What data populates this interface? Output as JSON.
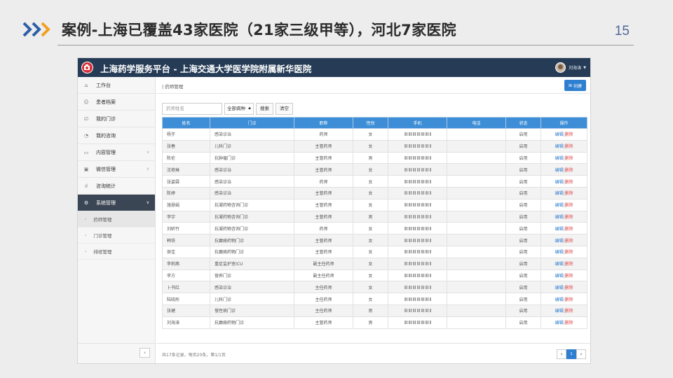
{
  "slide": {
    "title": "案例-上海已覆盖43家医院（21家三级甲等），河北7家医院",
    "page_number": "15"
  },
  "app": {
    "title": "上海药学服务平台 - 上海交通大学医学院附属新华医院",
    "user_name": "刘海涛",
    "brand_color": "#253b56"
  },
  "sidebar": {
    "items": [
      {
        "icon": "home-icon",
        "label": "工作台"
      },
      {
        "icon": "patient-icon",
        "label": "患者档案"
      },
      {
        "icon": "clinic-icon",
        "label": "我的门诊"
      },
      {
        "icon": "consult-icon",
        "label": "我的咨询"
      },
      {
        "icon": "content-icon",
        "label": "内容管理"
      },
      {
        "icon": "wechat-icon",
        "label": "微信管理"
      },
      {
        "icon": "chart-icon",
        "label": "咨询统计"
      },
      {
        "icon": "gears-icon",
        "label": "系统管理"
      }
    ],
    "sub_items": [
      "药师管理",
      "门诊管理",
      "排班管理"
    ]
  },
  "main": {
    "breadcrumb": "药师管理",
    "create_label": "创建",
    "search_placeholder": "药师姓名",
    "select_value": "全部病种",
    "search_label": "搜索",
    "clear_label": "清空"
  },
  "table": {
    "headers": [
      "姓名",
      "门诊",
      "职称",
      "性别",
      "手机",
      "电话",
      "状态",
      "操作"
    ],
    "rows": [
      {
        "name": "杨芋",
        "clinic": "感染诊治",
        "title": "药师",
        "gender": "女",
        "status": "启用"
      },
      {
        "name": "张春",
        "clinic": "儿科门诊",
        "title": "主管药师",
        "gender": "女",
        "status": "启用"
      },
      {
        "name": "陈伦",
        "clinic": "抗肿瘤门诊",
        "title": "主管药师",
        "gender": "男",
        "status": "启用"
      },
      {
        "name": "沈艳琳",
        "clinic": "感染诊治",
        "title": "主管药师",
        "gender": "女",
        "status": "启用"
      },
      {
        "name": "张姿霖",
        "clinic": "感染诊治",
        "title": "药师",
        "gender": "女",
        "status": "启用"
      },
      {
        "name": "陈婷",
        "clinic": "感染诊治",
        "title": "主管药师",
        "gender": "女",
        "status": "启用"
      },
      {
        "name": "施慧娟",
        "clinic": "抗凝药物咨询门诊",
        "title": "主管药师",
        "gender": "女",
        "status": "启用"
      },
      {
        "name": "李宇",
        "clinic": "抗凝药物咨询门诊",
        "title": "主管药师",
        "gender": "男",
        "status": "启用"
      },
      {
        "name": "刘昕竹",
        "clinic": "抗凝药物咨询门诊",
        "title": "药师",
        "gender": "女",
        "status": "启用"
      },
      {
        "name": "韩铁",
        "clinic": "抗癫痫药物门诊",
        "title": "主管药师",
        "gender": "女",
        "status": "启用"
      },
      {
        "name": "周佳",
        "clinic": "抗癫痫药物门诊",
        "title": "主管药师",
        "gender": "女",
        "status": "启用"
      },
      {
        "name": "李莉茜",
        "clinic": "重症监护室ICU",
        "title": "副主任药师",
        "gender": "女",
        "status": "启用"
      },
      {
        "name": "李方",
        "clinic": "营养门诊",
        "title": "副主任药师",
        "gender": "女",
        "status": "启用"
      },
      {
        "name": "卜书红",
        "clinic": "感染诊治",
        "title": "主任药师",
        "gender": "女",
        "status": "启用"
      },
      {
        "name": "陆晓彤",
        "clinic": "儿科门诊",
        "title": "主任药师",
        "gender": "女",
        "status": "启用"
      },
      {
        "name": "张健",
        "clinic": "慢性病门诊",
        "title": "主任药师",
        "gender": "男",
        "status": "启用"
      },
      {
        "name": "刘海涛",
        "clinic": "抗癫痫药物门诊",
        "title": "主管药师",
        "gender": "男",
        "status": "启用"
      }
    ],
    "edit_label": "编辑",
    "separator": "|",
    "delete_label": "删除"
  },
  "footer": {
    "summary": "共17条记录，每页20条，第1/1页",
    "current_page": "1"
  }
}
